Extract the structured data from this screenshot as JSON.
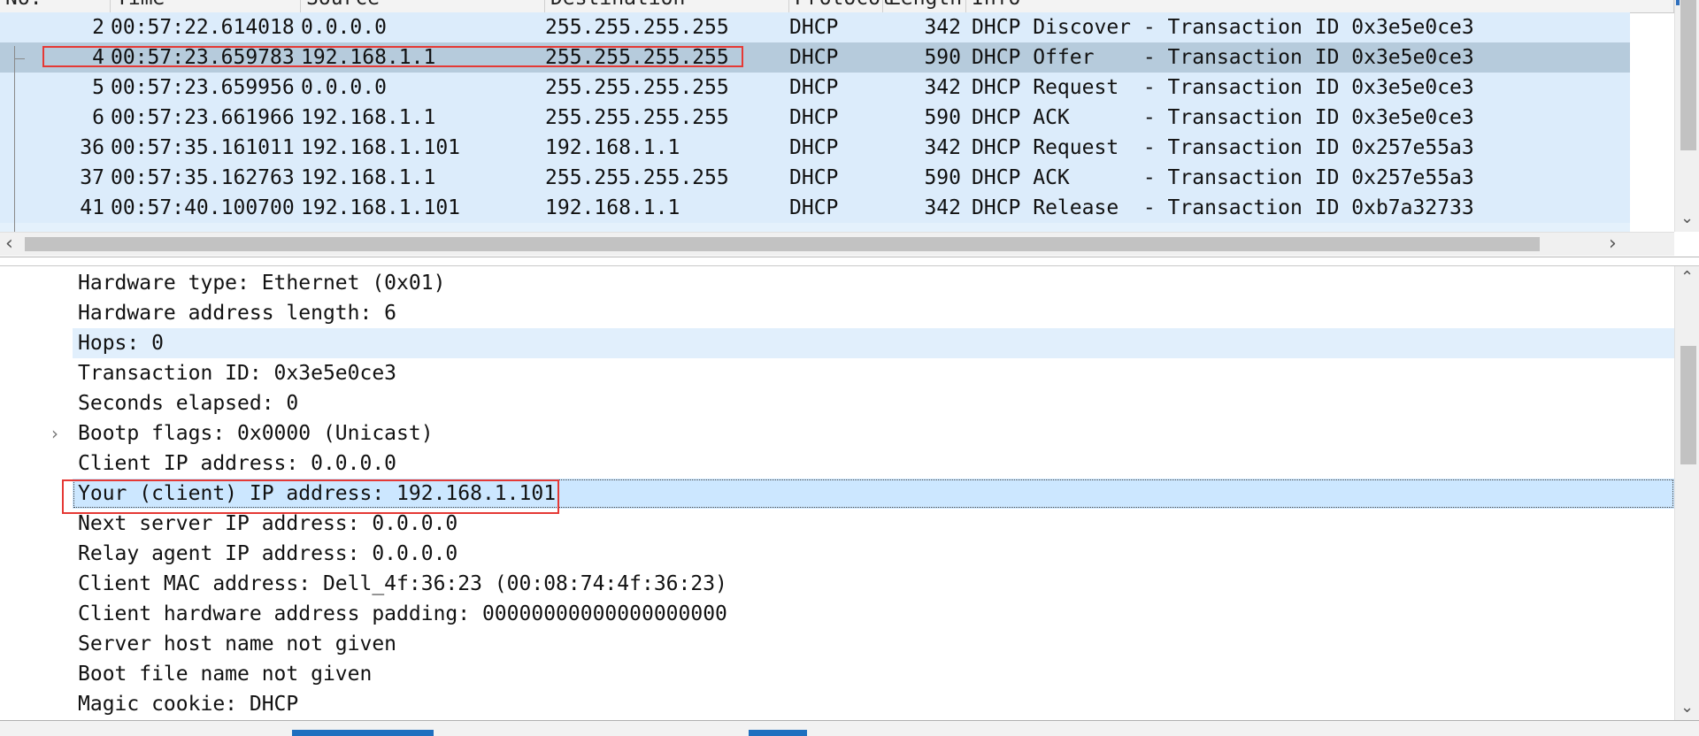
{
  "packet_list": {
    "columns": [
      "No.",
      "Time",
      "Source",
      "Destination",
      "Protocol",
      "Length",
      "Info"
    ],
    "rows": [
      {
        "no": "2",
        "time": "00:57:22.614018",
        "source": "0.0.0.0",
        "destination": "255.255.255.255",
        "protocol": "DHCP",
        "length": "342",
        "info": "DHCP Discover - Transaction ID 0x3e5e0ce3"
      },
      {
        "no": "4",
        "time": "00:57:23.659783",
        "source": "192.168.1.1",
        "destination": "255.255.255.255",
        "protocol": "DHCP",
        "length": "590",
        "info": "DHCP Offer    - Transaction ID 0x3e5e0ce3"
      },
      {
        "no": "5",
        "time": "00:57:23.659956",
        "source": "0.0.0.0",
        "destination": "255.255.255.255",
        "protocol": "DHCP",
        "length": "342",
        "info": "DHCP Request  - Transaction ID 0x3e5e0ce3"
      },
      {
        "no": "6",
        "time": "00:57:23.661966",
        "source": "192.168.1.1",
        "destination": "255.255.255.255",
        "protocol": "DHCP",
        "length": "590",
        "info": "DHCP ACK      - Transaction ID 0x3e5e0ce3"
      },
      {
        "no": "36",
        "time": "00:57:35.161011",
        "source": "192.168.1.101",
        "destination": "192.168.1.1",
        "protocol": "DHCP",
        "length": "342",
        "info": "DHCP Request  - Transaction ID 0x257e55a3"
      },
      {
        "no": "37",
        "time": "00:57:35.162763",
        "source": "192.168.1.1",
        "destination": "255.255.255.255",
        "protocol": "DHCP",
        "length": "590",
        "info": "DHCP ACK      - Transaction ID 0x257e55a3"
      },
      {
        "no": "41",
        "time": "00:57:40.100700",
        "source": "192.168.1.101",
        "destination": "192.168.1.1",
        "protocol": "DHCP",
        "length": "342",
        "info": "DHCP Release  - Transaction ID 0xb7a32733"
      }
    ],
    "selected_row_index": 1
  },
  "details": {
    "fields": [
      "Hardware type: Ethernet (0x01)",
      "Hardware address length: 6",
      "Hops: 0",
      "Transaction ID: 0x3e5e0ce3",
      "Seconds elapsed: 0",
      "Bootp flags: 0x0000 (Unicast)",
      "Client IP address: 0.0.0.0",
      "Your (client) IP address: 192.168.1.101",
      "Next server IP address: 0.0.0.0",
      "Relay agent IP address: 0.0.0.0",
      "Client MAC address: Dell_4f:36:23 (00:08:74:4f:36:23)",
      "Client hardware address padding: 00000000000000000000",
      "Server host name not given",
      "Boot file name not given",
      "Magic cookie: DHCP"
    ],
    "expandable_field_index": 5,
    "hover_field_index": 2,
    "selected_field_index": 7
  },
  "icons": {
    "expand": "chevron-right-icon",
    "scroll_left": "scroll-left-arrow-icon",
    "scroll_right": "scroll-right-arrow-icon",
    "scroll_up": "scroll-up-arrow-icon",
    "scroll_down": "scroll-down-arrow-icon"
  },
  "colors": {
    "row_background": "#dcecfb",
    "selected_row": "#b6cbdc",
    "selected_field": "#cce7ff",
    "annotation": "#e53935"
  }
}
